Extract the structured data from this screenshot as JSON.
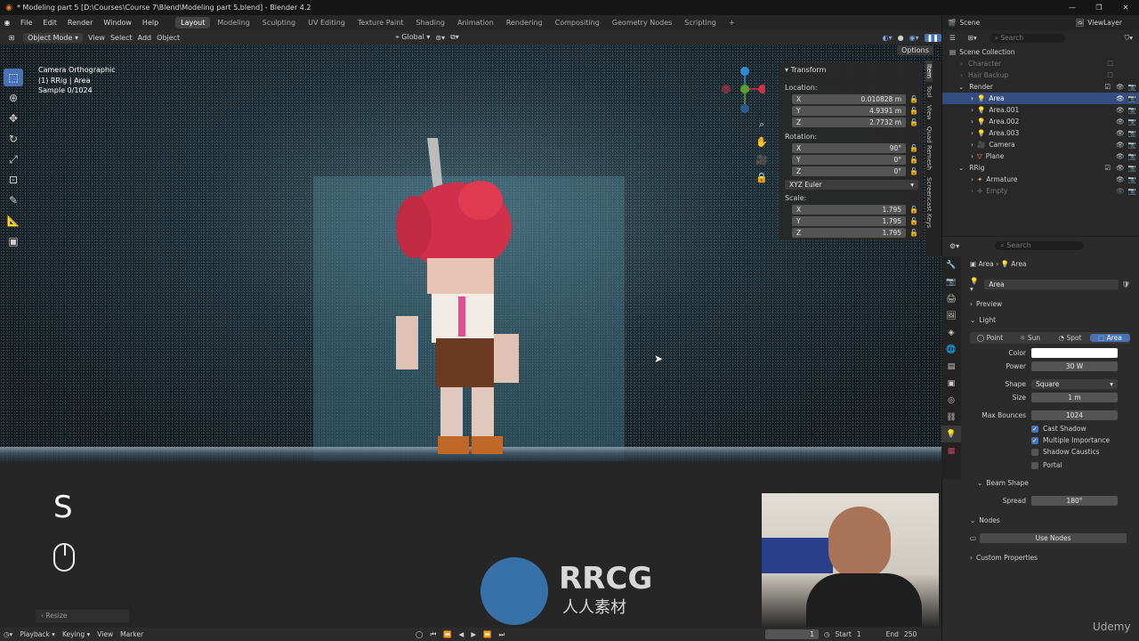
{
  "titlebar": {
    "title": "* Modeling part 5 [D:\\Courses\\Course 7\\Blend\\Modeling part 5.blend] - Blender 4.2"
  },
  "menu": {
    "items": [
      "File",
      "Edit",
      "Render",
      "Window",
      "Help"
    ]
  },
  "workspaces": {
    "tabs": [
      "Layout",
      "Modeling",
      "Sculpting",
      "UV Editing",
      "Texture Paint",
      "Shading",
      "Animation",
      "Rendering",
      "Compositing",
      "Geometry Nodes",
      "Scripting"
    ],
    "active": "Layout"
  },
  "topright": {
    "scene": "Scene",
    "viewlayer": "ViewLayer"
  },
  "header3d": {
    "mode": "Object Mode",
    "view": "View",
    "select": "Select",
    "add": "Add",
    "object": "Object",
    "orientation": "Global",
    "options": "Options"
  },
  "viewport": {
    "line1": "Camera Orthographic",
    "line2": "(1) RRig | Area",
    "line3": "Sample 0/1024"
  },
  "npanel": {
    "title": "Transform",
    "location_label": "Location:",
    "location": {
      "x": "0.010828 m",
      "y": "4.9391 m",
      "z": "2.7732 m"
    },
    "rotation_label": "Rotation:",
    "rotation": {
      "x": "90°",
      "y": "0°",
      "z": "0°"
    },
    "rotation_mode": "XYZ Euler",
    "scale_label": "Scale:",
    "scale": {
      "x": "1.795",
      "y": "1.795",
      "z": "1.795"
    },
    "axis": {
      "x": "X",
      "y": "Y",
      "z": "Z"
    }
  },
  "sidetabs": [
    "Item",
    "Tool",
    "View",
    "Quad Remesh",
    "Screencast Keys"
  ],
  "outliner": {
    "search_placeholder": "Search",
    "rows": [
      {
        "name": "Scene Collection"
      },
      {
        "name": "Character"
      },
      {
        "name": "Hair Backup"
      },
      {
        "name": "Render"
      },
      {
        "name": "Area"
      },
      {
        "name": "Area.001"
      },
      {
        "name": "Area.002"
      },
      {
        "name": "Area.003"
      },
      {
        "name": "Camera"
      },
      {
        "name": "Plane"
      },
      {
        "name": "RRig"
      },
      {
        "name": "Armature"
      },
      {
        "name": "Empty"
      }
    ]
  },
  "properties": {
    "search_placeholder": "Search",
    "breadcrumb": [
      "Area",
      "Area"
    ],
    "datablock": "Area",
    "preview": "Preview",
    "light": "Light",
    "light_types": [
      "Point",
      "Sun",
      "Spot",
      "Area"
    ],
    "active_type": "Area",
    "color_label": "Color",
    "power_label": "Power",
    "power": "30 W",
    "shape_label": "Shape",
    "shape": "Square",
    "size_label": "Size",
    "size": "1 m",
    "bounces_label": "Max Bounces",
    "bounces": "1024",
    "cast_shadow": "Cast Shadow",
    "multiple_importance": "Multiple Importance",
    "shadow_caustics": "Shadow Caustics",
    "portal": "Portal",
    "beam_shape": "Beam Shape",
    "spread_label": "Spread",
    "spread": "180°",
    "nodes": "Nodes",
    "use_nodes": "Use Nodes",
    "custom_props": "Custom Properties"
  },
  "overlay": {
    "key": "S",
    "resize": "Resize"
  },
  "timeline": {
    "playback": "Playback",
    "keying": "Keying",
    "view": "View",
    "marker": "Marker",
    "frame": "1",
    "start_label": "Start",
    "start": "1",
    "end_label": "End",
    "end": "250"
  },
  "watermark": {
    "logo": "RRCG",
    "sub": "人人素材"
  },
  "udemy": "Udemy",
  "colors": {
    "accent": "#4772b3",
    "selected_row": "#334d80"
  }
}
